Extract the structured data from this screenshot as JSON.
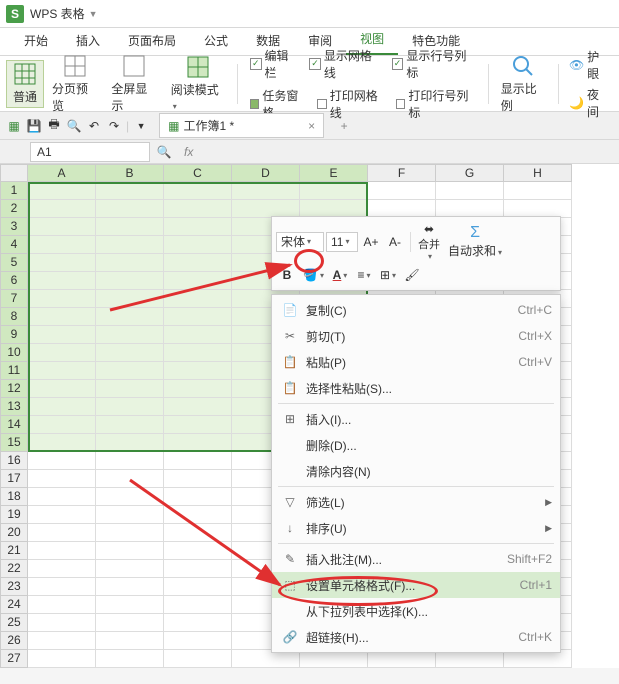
{
  "title": "WPS 表格",
  "menus": [
    "开始",
    "插入",
    "页面布局",
    "公式",
    "数据",
    "审阅",
    "视图",
    "特色功能"
  ],
  "active_menu": 6,
  "ribbon": {
    "view_btns": [
      "普通",
      "分页预览",
      "全屏显示",
      "阅读模式"
    ],
    "chk1": [
      [
        "编辑栏",
        "显示网格线",
        "显示行号列标"
      ],
      [
        "任务窗格",
        "打印网格线",
        "打印行号列标"
      ]
    ],
    "zoom": "显示比例",
    "eye": "护眼",
    "night": "夜间"
  },
  "doc": {
    "name": "工作簿1 *"
  },
  "namebox": "A1",
  "cols": [
    "A",
    "B",
    "C",
    "D",
    "E",
    "F",
    "G",
    "H"
  ],
  "rows": 27,
  "sel": {
    "r": 15,
    "c": 5
  },
  "mini": {
    "font": "宋体",
    "size": "11",
    "merge": "合并",
    "sum": "自动求和"
  },
  "ctx": [
    {
      "ico": "📄",
      "lbl": "复制(C)",
      "sc": "Ctrl+C"
    },
    {
      "ico": "✂",
      "lbl": "剪切(T)",
      "sc": "Ctrl+X"
    },
    {
      "ico": "📋",
      "lbl": "粘贴(P)",
      "sc": "Ctrl+V"
    },
    {
      "ico": "📋",
      "lbl": "选择性粘贴(S)..."
    },
    {
      "sep": true
    },
    {
      "ico": "⊞",
      "lbl": "插入(I)..."
    },
    {
      "lbl": "删除(D)..."
    },
    {
      "lbl": "清除内容(N)"
    },
    {
      "sep": true
    },
    {
      "ico": "▽",
      "lbl": "筛选(L)",
      "sub": true
    },
    {
      "ico": "↓",
      "lbl": "排序(U)",
      "sub": true
    },
    {
      "sep": true
    },
    {
      "ico": "✎",
      "lbl": "插入批注(M)...",
      "sc": "Shift+F2"
    },
    {
      "ico": "⬚",
      "lbl": "设置单元格格式(F)...",
      "sc": "Ctrl+1",
      "hl": true
    },
    {
      "lbl": "从下拉列表中选择(K)..."
    },
    {
      "ico": "🔗",
      "lbl": "超链接(H)...",
      "sc": "Ctrl+K"
    }
  ]
}
